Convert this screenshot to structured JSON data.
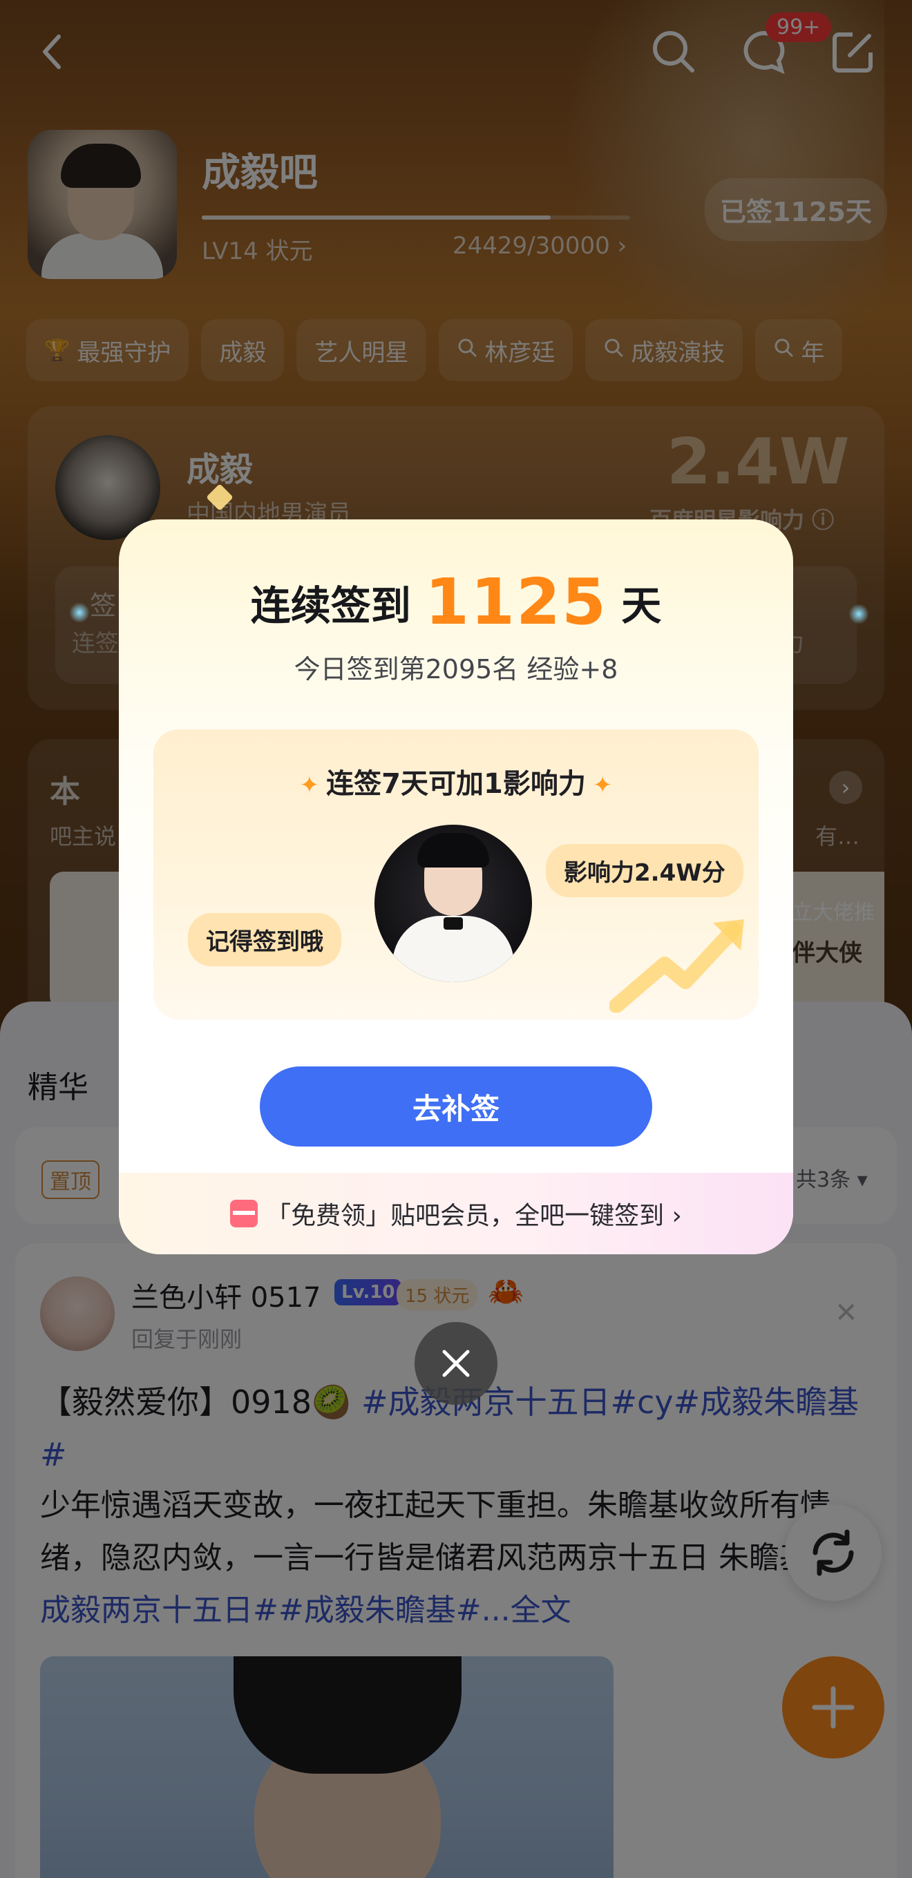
{
  "header": {
    "forum_name": "成毅吧",
    "level": "LV14 状元",
    "exp": "24429/30000 ›",
    "exp_fraction": 0.8143,
    "signed_pill": "已签1125天",
    "message_badge": "99+",
    "icons": [
      "back-icon",
      "search-icon",
      "message-icon",
      "edit-icon"
    ]
  },
  "tags": [
    {
      "label": "最强守护",
      "icon": "trophy-icon"
    },
    {
      "label": "成毅",
      "icon": ""
    },
    {
      "label": "艺人明星",
      "icon": ""
    },
    {
      "label": "林彦廷",
      "icon": "search-icon"
    },
    {
      "label": "成毅演技",
      "icon": "search-icon"
    },
    {
      "label": "年",
      "icon": "search-icon"
    }
  ],
  "star_card": {
    "name": "成毅",
    "desc": "中国内地男演员",
    "influence": "2.4W",
    "influence_label": "百度明星影响力 ⓘ",
    "sign_partial": "签",
    "sign_partial2": "连签",
    "right_partial": "力"
  },
  "card2": {
    "title": "本",
    "sub": "吧主说",
    "right_sub": "有…",
    "banner_top": "立大佬推",
    "banner_text": "伴大侠"
  },
  "feed": {
    "section_title": "精华",
    "pin_label": "置顶",
    "pin_more": "共3条",
    "post": {
      "author": "兰色小轩 0517",
      "level_badge": "Lv.10",
      "rank_badge": "15 状元",
      "time": "回复于刚刚",
      "title_prefix": "【毅然爱你】0918🥝 ",
      "title_tags": "#成毅两京十五日#cy#成毅朱瞻基#",
      "body": "少年惊遇滔天变故，一夜扛起天下重担。朱瞻基收敛所有情绪，隐忍内敛，一言一行皆是储君风范两京十五日 朱瞻基 ",
      "body_tags": "#成毅两京十五日##成毅朱瞻基#",
      "body_more": "...全文"
    }
  },
  "modal": {
    "title_prefix": "连续签到",
    "days": "1125",
    "title_suffix": "天",
    "subtitle": "今日签到第2095名 经验+8",
    "promo_title": "连签7天可加1影响力",
    "bubble_left": "记得签到哦",
    "bubble_right": "影响力2.4W分",
    "cta": "去补签",
    "vip_text": "「免费领」贴吧会员，全吧一键签到 ›"
  },
  "colors": {
    "accent_orange": "#ff8716",
    "cta_blue": "#3f6ff5",
    "hashtag_blue": "#3b55c9"
  }
}
